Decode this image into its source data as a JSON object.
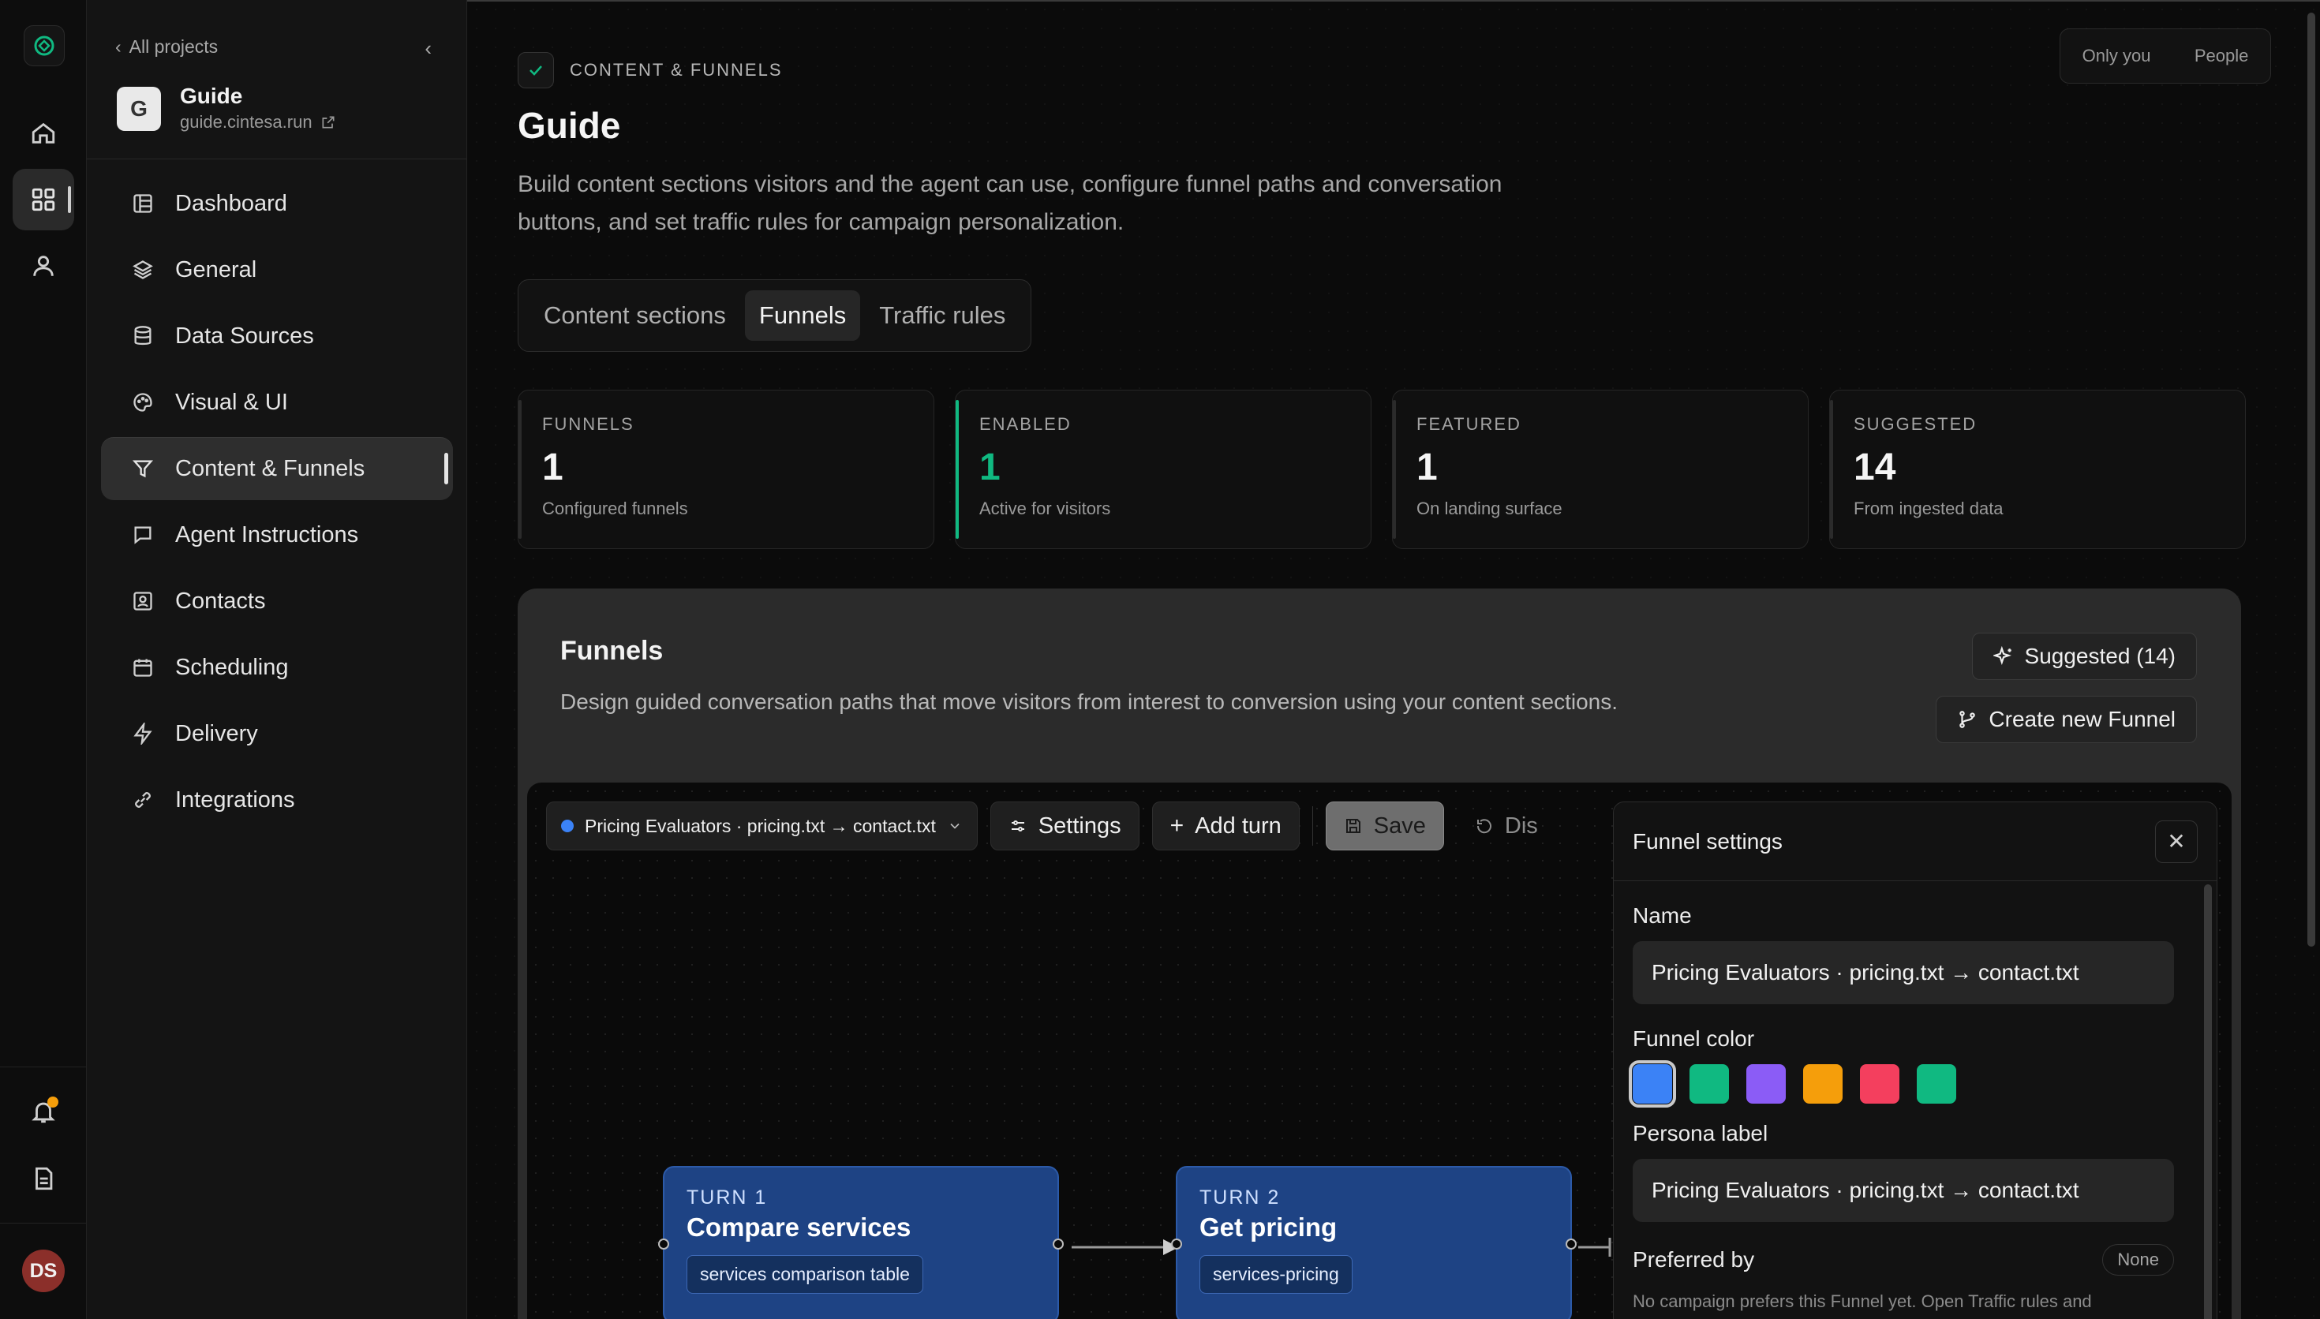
{
  "nav": {
    "back": "All projects",
    "project": {
      "name": "Guide",
      "url": "guide.cintesa.run",
      "logo_text": "G"
    },
    "items": [
      {
        "label": "Dashboard",
        "icon": "dashboard-icon"
      },
      {
        "label": "General",
        "icon": "layers-icon"
      },
      {
        "label": "Data Sources",
        "icon": "database-icon"
      },
      {
        "label": "Visual & UI",
        "icon": "palette-icon"
      },
      {
        "label": "Content & Funnels",
        "icon": "filter-icon",
        "active": true
      },
      {
        "label": "Agent Instructions",
        "icon": "chat-icon"
      },
      {
        "label": "Contacts",
        "icon": "contact-card-icon"
      },
      {
        "label": "Scheduling",
        "icon": "calendar-icon"
      },
      {
        "label": "Delivery",
        "icon": "bolt-icon"
      },
      {
        "label": "Integrations",
        "icon": "link-icon"
      }
    ]
  },
  "rail": {
    "avatar_initials": "DS"
  },
  "header": {
    "crumb": "CONTENT & FUNNELS",
    "title": "Guide",
    "description": "Build content sections visitors and the agent can use, configure funnel paths and conversation buttons, and set traffic rules for campaign personalization.",
    "visibility": {
      "only_you": "Only you",
      "people": "People"
    }
  },
  "tabs": [
    "Content sections",
    "Funnels",
    "Traffic rules"
  ],
  "active_tab": "Funnels",
  "stats": [
    {
      "label": "FUNNELS",
      "value": "1",
      "sub": "Configured funnels"
    },
    {
      "label": "ENABLED",
      "value": "1",
      "sub": "Active for visitors"
    },
    {
      "label": "FEATURED",
      "value": "1",
      "sub": "On landing surface"
    },
    {
      "label": "SUGGESTED",
      "value": "14",
      "sub": "From ingested data"
    }
  ],
  "panel": {
    "title": "Funnels",
    "description": "Design guided conversation paths that move visitors from interest to conversion using your content sections.",
    "suggested_button": "Suggested (14)",
    "create_button": "Create new Funnel"
  },
  "toolbar": {
    "funnel_select": "Pricing Evaluators · pricing.txt → contact.txt",
    "settings": "Settings",
    "add_turn": "Add turn",
    "save": "Save",
    "discard": "Dis"
  },
  "turns": [
    {
      "number": "TURN 1",
      "title": "Compare services",
      "chip": "services comparison table"
    },
    {
      "number": "TURN 2",
      "title": "Get pricing",
      "chip": "services-pricing"
    }
  ],
  "settings_panel": {
    "title": "Funnel settings",
    "name_label": "Name",
    "name_value": "Pricing Evaluators · pricing.txt → contact.txt",
    "color_label": "Funnel color",
    "colors": [
      "#3b82f6",
      "#10b981",
      "#8b5cf6",
      "#f59e0b",
      "#f43f5e",
      "#10b981"
    ],
    "persona_label": "Persona label",
    "persona_value": "Pricing Evaluators · pricing.txt → contact.txt",
    "preferred_label": "Preferred by",
    "preferred_badge": "None",
    "preferred_note": "No campaign prefers this Funnel yet. Open Traffic rules and"
  },
  "colors": {
    "accent": "#10b981",
    "turn_blue": "#1e4384",
    "notif": "#f59e0b",
    "avatar": "#8b2f2a"
  }
}
